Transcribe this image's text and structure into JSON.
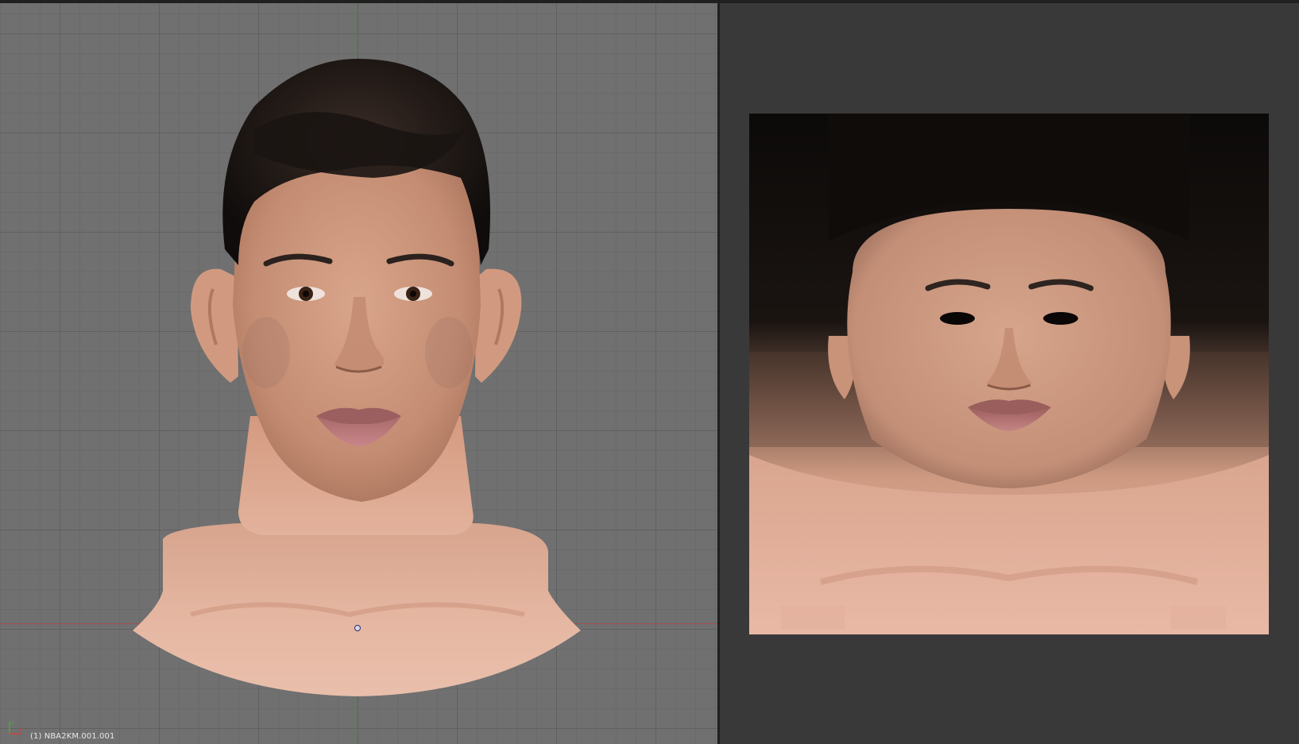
{
  "viewport": {
    "object_label": "(1) NBA2KM.001.001",
    "background_color": "#707070",
    "grid_color": "#5f5f5f",
    "x_axis_color": "#a55050",
    "y_axis_color": "#4d8a40"
  },
  "image_editor": {
    "background_color": "#393939"
  },
  "icons": {
    "axes": "axes-gizmo-icon",
    "origin": "origin-point-icon"
  }
}
